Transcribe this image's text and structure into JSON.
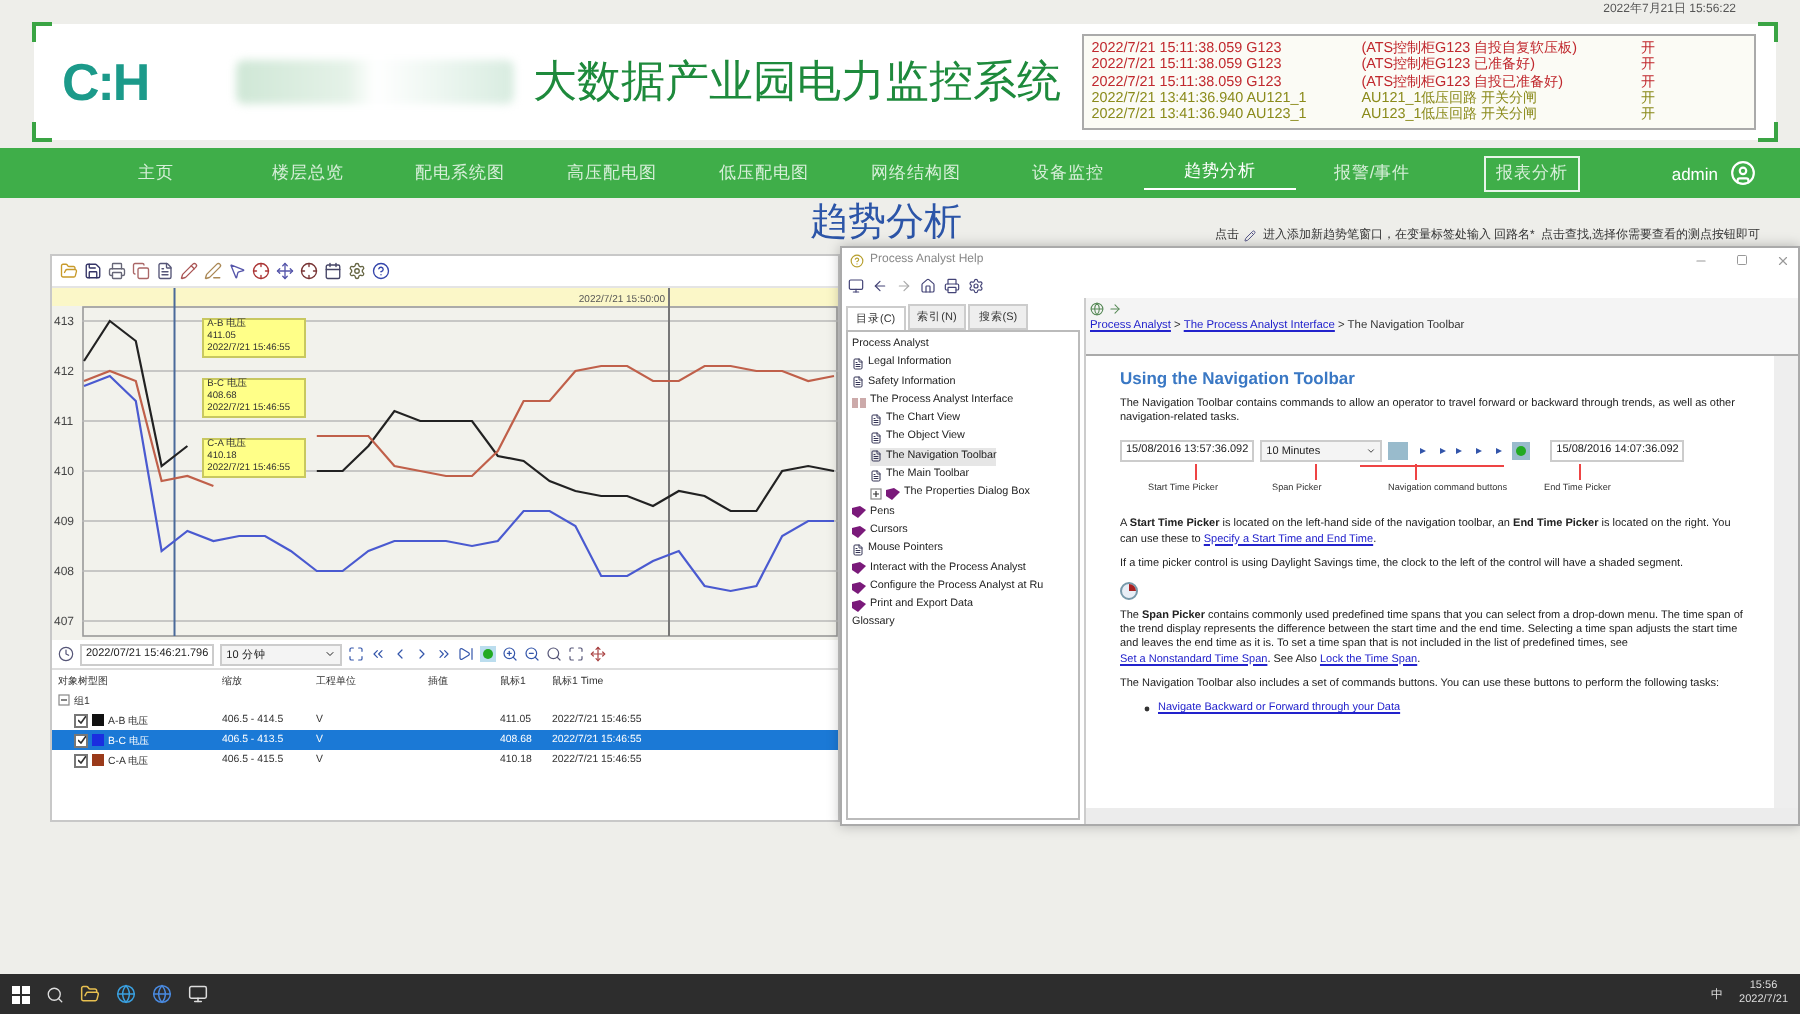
{
  "clock": "2022年7月21日 15:56:22",
  "header": {
    "logo": "C:H",
    "title": "大数据产业园电力监控系统",
    "alarms": [
      {
        "time": "2022/7/21 15:11:38.059 G123",
        "desc": "(ATS控制柜G123 自投自复软压板)",
        "state": "开",
        "color": "#c0282d"
      },
      {
        "time": "2022/7/21 15:11:38.059 G123",
        "desc": "(ATS控制柜G123 已准备好)",
        "state": "开",
        "color": "#c0282d"
      },
      {
        "time": "2022/7/21 15:11:38.059 G123",
        "desc": "(ATS控制柜G123 自投已准备好)",
        "state": "开",
        "color": "#c0282d"
      },
      {
        "time": "2022/7/21 13:41:36.940 AU121_1",
        "desc": "AU121_1低压回路 开关分闸",
        "state": "开",
        "color": "#8a8a1a"
      },
      {
        "time": "2022/7/21 13:41:36.940 AU123_1",
        "desc": "AU123_1低压回路 开关分闸",
        "state": "开",
        "color": "#8a8a1a"
      }
    ]
  },
  "nav": {
    "items": [
      {
        "label": "主页",
        "selected": false,
        "kind": "link"
      },
      {
        "label": "楼层总览",
        "selected": false,
        "kind": "link"
      },
      {
        "label": "配电系统图",
        "selected": false,
        "kind": "link"
      },
      {
        "label": "高压配电图",
        "selected": false,
        "kind": "link"
      },
      {
        "label": "低压配电图",
        "selected": false,
        "kind": "link"
      },
      {
        "label": "网络结构图",
        "selected": false,
        "kind": "link"
      },
      {
        "label": "设备监控",
        "selected": false,
        "kind": "link"
      },
      {
        "label": "趋势分析",
        "selected": true,
        "kind": "link"
      },
      {
        "label": "报警/事件",
        "selected": false,
        "kind": "link"
      },
      {
        "label": "报表分析",
        "selected": false,
        "kind": "button"
      }
    ],
    "user": "admin"
  },
  "page_title": "趋势分析",
  "hint": {
    "before": "点击",
    "middle": "进入添加新趋势笔窗口，在变量标签处输入 回路名*",
    "after": "点击查找,选择你需要查看的测点按钮即可"
  },
  "trend": {
    "chart_data": {
      "type": "line",
      "ylim": [
        406.7,
        413.3
      ],
      "yticks": [
        407,
        408,
        409,
        410,
        411,
        412,
        413
      ],
      "grid": true,
      "series": [
        {
          "name": "A-B 电压",
          "color": "#222222",
          "values": [
            412.2,
            413.0,
            412.6,
            410.1,
            410.5,
            null,
            null,
            null,
            null,
            410.0,
            410.0,
            410.5,
            411.2,
            411.0,
            411.0,
            411.0,
            410.3,
            410.2,
            409.8,
            409.6,
            409.5,
            409.5,
            409.3,
            409.6,
            409.5,
            409.2,
            409.2,
            410.0,
            410.1,
            410.0
          ]
        },
        {
          "name": "B-C 电压",
          "color": "#4a5ad0",
          "values": [
            411.7,
            411.9,
            411.4,
            408.4,
            408.8,
            408.6,
            408.7,
            408.7,
            408.4,
            408.0,
            408.0,
            408.4,
            408.6,
            408.6,
            408.6,
            408.5,
            408.6,
            409.2,
            409.2,
            408.9,
            407.9,
            407.9,
            408.2,
            408.4,
            407.7,
            407.6,
            407.7,
            408.7,
            409.0,
            409.0
          ]
        },
        {
          "name": "C-A 电压",
          "color": "#c0604a",
          "values": [
            411.8,
            412.0,
            411.8,
            409.8,
            409.9,
            409.7,
            null,
            null,
            null,
            410.7,
            410.7,
            410.7,
            410.1,
            410.0,
            409.9,
            409.9,
            410.4,
            411.4,
            411.4,
            412.0,
            412.1,
            412.1,
            411.8,
            411.8,
            412.1,
            412.1,
            412.0,
            412.0,
            411.8,
            411.9
          ]
        }
      ]
    },
    "time_label": "2022/7/21 15:50:00",
    "tooltips": [
      {
        "value": "411.05",
        "time": "2022/7/21 15:46:55"
      },
      {
        "value": "408.68",
        "time": "2022/7/21 15:46:55"
      },
      {
        "value": "410.18",
        "time": "2022/7/21 15:46:55"
      }
    ],
    "time_picker": "2022/07/21 15:46:21.796",
    "span": "10 分钟",
    "table": {
      "columns": [
        "对象树型图",
        "缩放",
        "工程单位",
        "插值",
        "鼠标1",
        "鼠标1 Time"
      ],
      "group": "组1",
      "rows": [
        {
          "name": "A-B 电压",
          "color": "#111111",
          "checked": true,
          "selected": false,
          "scale": "406.5 - 414.5",
          "unit": "V",
          "cursor": "411.05",
          "time": "2022/7/21 15:46:55"
        },
        {
          "name": "B-C 电压",
          "color": "#1a2ee0",
          "checked": true,
          "selected": true,
          "scale": "406.5 - 413.5",
          "unit": "V",
          "cursor": "408.68",
          "time": "2022/7/21 15:46:55"
        },
        {
          "name": "C-A 电压",
          "color": "#9a3a1a",
          "checked": true,
          "selected": false,
          "scale": "406.5 - 415.5",
          "unit": "V",
          "cursor": "410.18",
          "time": "2022/7/21 15:46:55"
        }
      ]
    }
  },
  "help": {
    "title": "Process Analyst Help",
    "tabs": [
      {
        "label": "目录(C)",
        "selected": true
      },
      {
        "label": "索引(N)",
        "selected": false
      },
      {
        "label": "搜索(S)",
        "selected": false
      }
    ],
    "tree": [
      {
        "label": "Process Analyst",
        "kind": "none",
        "selected": false
      },
      {
        "label": "Legal Information",
        "kind": "page",
        "selected": false
      },
      {
        "label": "Safety Information",
        "kind": "page",
        "selected": false
      },
      {
        "label": "The Process Analyst Interface",
        "kind": "open-book",
        "selected": false,
        "expanded": true,
        "children": [
          {
            "label": "The Chart View",
            "kind": "page",
            "selected": false
          },
          {
            "label": "The Object View",
            "kind": "page",
            "selected": false
          },
          {
            "label": "The Navigation Toolbar",
            "kind": "page",
            "selected": true
          },
          {
            "label": "The Main Toolbar",
            "kind": "page",
            "selected": false
          },
          {
            "label": "The Properties Dialog Box",
            "kind": "book",
            "selected": false,
            "expanded": false
          }
        ]
      },
      {
        "label": "Pens",
        "kind": "book",
        "selected": false
      },
      {
        "label": "Cursors",
        "kind": "book",
        "selected": false
      },
      {
        "label": "Mouse Pointers",
        "kind": "page",
        "selected": false
      },
      {
        "label": "Interact with the Process Analyst",
        "kind": "book",
        "selected": false
      },
      {
        "label": "Configure the Process Analyst at Ru",
        "kind": "book",
        "selected": false
      },
      {
        "label": "Print and Export Data",
        "kind": "book",
        "selected": false
      },
      {
        "label": "Glossary",
        "kind": "none",
        "selected": false
      }
    ],
    "breadcrumb": [
      {
        "kind": "link",
        "text": "Process Analyst"
      },
      {
        "kind": "text",
        "text": " > "
      },
      {
        "kind": "link",
        "text": "The Process Analyst Interface"
      },
      {
        "kind": "text",
        "text": " > The Navigation Toolbar"
      }
    ],
    "heading": "Using the Navigation Toolbar",
    "intro": "The Navigation Toolbar contains commands to allow an operator to travel forward or backward through trends, as well as other navigation-related tasks.",
    "figure": {
      "start": "15/08/2016 13:57:36.092",
      "span": "10 Minutes",
      "end": "15/08/2016 14:07:36.092",
      "labels": [
        "Start Time Picker",
        "Span Picker",
        "Navigation command buttons",
        "End Time Picker"
      ]
    },
    "paragraphs": [
      {
        "parts": [
          {
            "kind": "text",
            "text": "A **Start Time Picker** is located on the left-hand side of the navigation toolbar, an **End Time Picker** is located on the right. You can use these to "
          },
          {
            "kind": "link",
            "text": "Specify a Start Time and End Time"
          },
          {
            "kind": "text",
            "text": "."
          }
        ]
      },
      {
        "parts": [
          {
            "kind": "text",
            "text": "If a time picker control is using Daylight Savings time, the clock to the left of the control will have a shaded segment."
          }
        ]
      },
      {
        "kind": "clock-image"
      },
      {
        "parts": [
          {
            "kind": "text",
            "text": "The **Span Picker** contains commonly used predefined time spans that you can select from a drop-down menu. The time span of the trend display represents the difference between the start time and the end time. Selecting a time span adjusts the start time and leaves the end time as it is. To set a time span that is not included in the list of predefined times, see "
          },
          {
            "kind": "link",
            "text": "Set a Nonstandard Time Span"
          },
          {
            "kind": "text",
            "text": ". See Also "
          },
          {
            "kind": "link",
            "text": "Lock the Time Span"
          },
          {
            "kind": "text",
            "text": "."
          }
        ]
      },
      {
        "parts": [
          {
            "kind": "text",
            "text": "The Navigation Toolbar also includes a set of commands buttons. You can use these buttons to perform the following tasks:"
          }
        ]
      }
    ],
    "bullets": [
      "Navigate Backward or Forward through your Data"
    ]
  },
  "taskbar": {
    "ime": "中",
    "time": "15:56",
    "date": "2022/7/21"
  }
}
